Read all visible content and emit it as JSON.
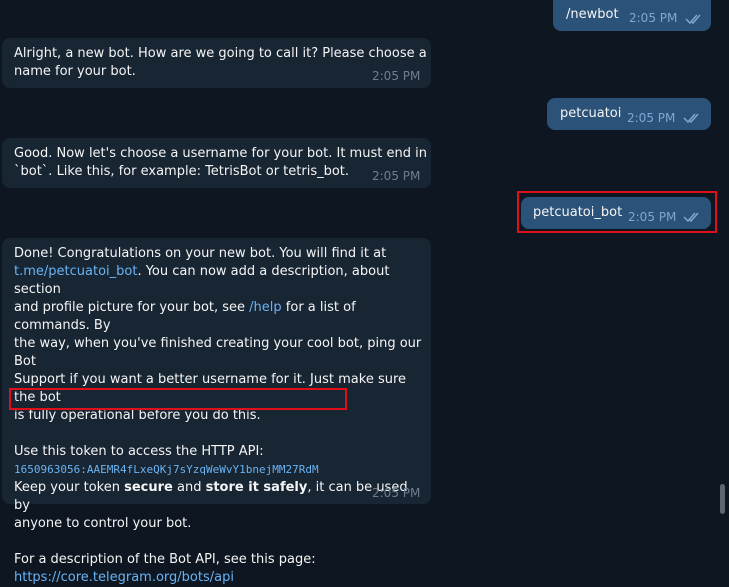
{
  "messages": [
    {
      "id": "m1",
      "dir": "out",
      "text": "/newbot",
      "time": "2:05 PM"
    },
    {
      "id": "m2",
      "dir": "in",
      "lines": [
        "Alright, a new bot. How are we going to call it? Please choose a",
        "name for your bot."
      ],
      "time": "2:05 PM"
    },
    {
      "id": "m3",
      "dir": "out",
      "text": "petcuatoi",
      "time": "2:05 PM"
    },
    {
      "id": "m4",
      "dir": "in",
      "lines": [
        "Good. Now let's choose a username for your bot. It must end in",
        "`bot`. Like this, for example: TetrisBot or tetris_bot."
      ],
      "time": "2:05 PM"
    },
    {
      "id": "m5",
      "dir": "out",
      "text": "petcuatoi_bot",
      "time": "2:05 PM"
    },
    {
      "id": "m6",
      "dir": "in",
      "time": "2:05 PM"
    }
  ],
  "done_message": {
    "line1": "Done! Congratulations on your new bot. You will find it at",
    "link_tme": "t.me/petcuatoi_bot",
    "line2_rest": ". You can now add a description, about section",
    "line3_pre": "and profile picture for your bot, see ",
    "link_help": "/help",
    "line3_rest": " for a list of commands. By",
    "line4": "the way, when you've finished creating your cool bot, ping our Bot",
    "line5": "Support if you want a better username for it. Just make sure the bot",
    "line6": "is fully operational before you do this.",
    "token_intro": "Use this token to access the HTTP API:",
    "token": "1650963056:AAEMR4fLxeQKj7sYzqWeWvY1bnejMM27RdM",
    "keep_pre": "Keep your token ",
    "keep_bold1": "secure",
    "keep_mid": " and ",
    "keep_bold2": "store it safely",
    "keep_rest": ", it can be used by",
    "keep_line2": "anyone to control your bot.",
    "api_intro": "For a description of the Bot API, see this page:",
    "api_link": "https://core.telegram.org/bots/api"
  },
  "colors": {
    "background": "#0e1621",
    "incoming": "#182533",
    "outgoing": "#2b5278",
    "link": "#6ab3f3",
    "highlight": "#e0101a"
  }
}
